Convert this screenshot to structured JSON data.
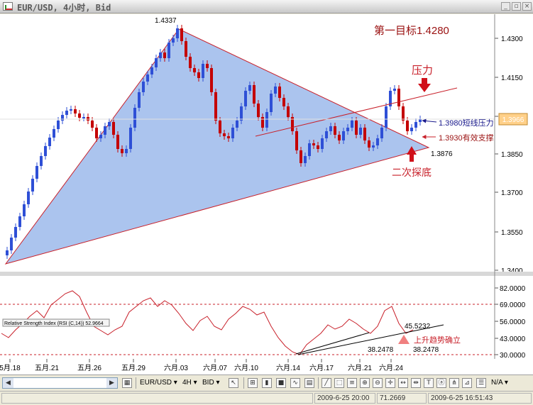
{
  "window": {
    "title": "EUR/USD, 4小时, Bid"
  },
  "price_panel": {
    "y_ticks": [
      "1.4300",
      "1.4150",
      "1.4000",
      "1.3850",
      "1.3700",
      "1.3550",
      "1.3400"
    ],
    "current_price": "1.3966",
    "annotations": {
      "peak": "1.4337",
      "target": "第一目标1.4280",
      "resistance_label": "压力",
      "short_resistance": "1.3980短线压力",
      "support": "1.3930有效支撑",
      "low_value": "1.3876",
      "retest": "二次探底"
    }
  },
  "rsi_panel": {
    "indicator_label": "Relative Strength Index (RSI (C,14)) 52.9664",
    "y_ticks": [
      "82.0000",
      "69.0000",
      "56.0000",
      "43.0000",
      "30.0000"
    ],
    "current_value": "45.5232",
    "annotations": {
      "low_a": "38.2478",
      "low_b": "38.2478",
      "trend": "上升趋势确立"
    }
  },
  "x_ticks": [
    "5月.18",
    "五月.21",
    "五月.26",
    "五月.29",
    "六月.03",
    "六月.07",
    "六月.10",
    "六月.14",
    "六月.17",
    "六月.21",
    "六月.24"
  ],
  "toolbar": {
    "symbol": "EUR/USD",
    "period": "4H",
    "side": "BID",
    "zoom_value": "N/A"
  },
  "status": {
    "cursor_time": "2009-6-25 20:00",
    "cursor_value": "71.2669",
    "clock": "2009-6-25 16:51:43"
  },
  "colors": {
    "bull": "#2e4fd6",
    "bear": "#c40000",
    "triangle_fill": "#8fb0e8",
    "line": "#c8202a",
    "tag": "#c8202a"
  }
}
